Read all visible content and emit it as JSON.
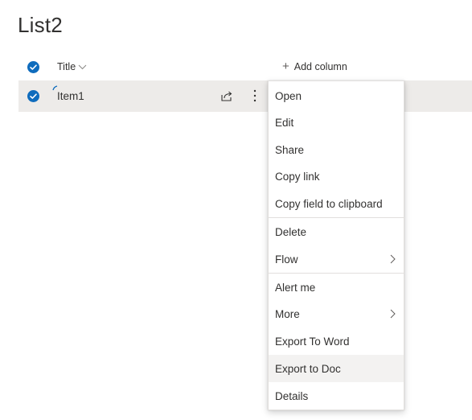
{
  "page": {
    "title": "List2"
  },
  "header": {
    "title_column": "Title",
    "add_column": "Add column",
    "add_column_icon": "plus-icon",
    "sort_icon": "chevron-down-icon"
  },
  "rows": [
    {
      "title": "Item1",
      "selected": true
    }
  ],
  "menu": {
    "items": [
      {
        "label": "Open"
      },
      {
        "label": "Edit"
      },
      {
        "label": "Share"
      },
      {
        "label": "Copy link"
      },
      {
        "label": "Copy field to clipboard"
      },
      {
        "label": "Delete"
      },
      {
        "label": "Flow",
        "submenu": true
      },
      {
        "label": "Alert me"
      },
      {
        "label": "More",
        "submenu": true
      },
      {
        "label": "Export To Word"
      },
      {
        "label": "Export to Doc",
        "hovered": true
      },
      {
        "label": "Details"
      }
    ]
  },
  "colors": {
    "accent": "#0f6cbd",
    "row_selected_bg": "#edebe9",
    "menu_hover_bg": "#f3f2f1"
  }
}
